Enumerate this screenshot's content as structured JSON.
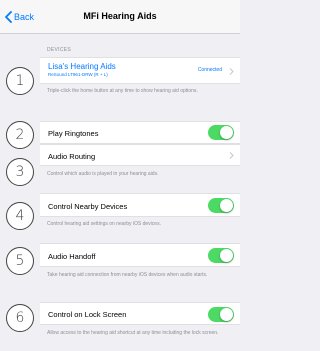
{
  "nav": {
    "back_label": "Back",
    "title": "MFi Hearing Aids"
  },
  "devices": {
    "header": "DEVICES",
    "name": "Lisa's Hearing Aids",
    "model": "ReSound LT961-DRW (R + L)",
    "status": "Connected",
    "footer": "Triple-click the home button at any time to show hearing aid options."
  },
  "play_ringtones": {
    "label": "Play Ringtones",
    "on": true
  },
  "audio_routing": {
    "label": "Audio Routing",
    "footer": "Control which audio is played in your hearing aids."
  },
  "control_nearby": {
    "label": "Control Nearby Devices",
    "on": true,
    "footer": "Control hearing aid settings on nearby iOS devices."
  },
  "audio_handoff": {
    "label": "Audio Handoff",
    "on": true,
    "footer": "Take hearing aid connection from nearby iOS devices when audio starts."
  },
  "lock_screen": {
    "label": "Control on Lock Screen",
    "on": true,
    "footer": "Allow access to the hearing aid shortcut at any time including the lock screen."
  },
  "callouts": [
    "1",
    "2",
    "3",
    "4",
    "5",
    "6"
  ],
  "colors": {
    "accent": "#007aff",
    "toggle_on": "#4cd964",
    "background": "#efeff4"
  }
}
